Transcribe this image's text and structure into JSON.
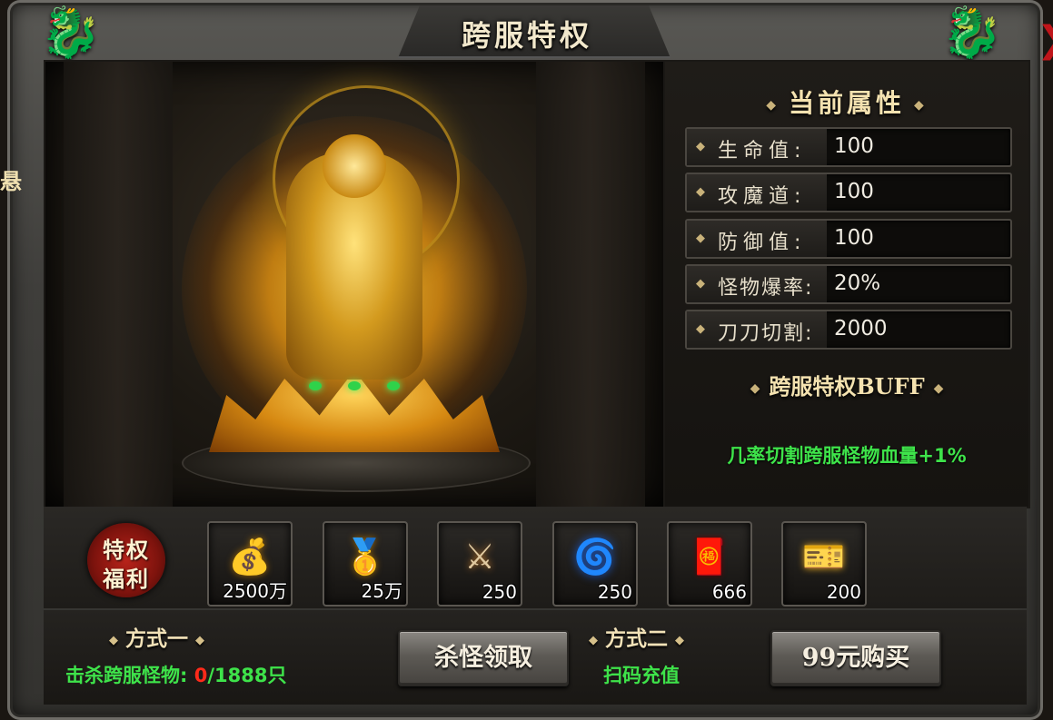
{
  "window": {
    "title": "跨服特权",
    "close_mark": "❯"
  },
  "left_edge_text": "悬",
  "current_attributes": {
    "heading": "当前属性",
    "rows": [
      {
        "label": "生命值:",
        "value": "100"
      },
      {
        "label": "攻魔道:",
        "value": "100"
      },
      {
        "label": "防御值:",
        "value": "100"
      },
      {
        "label": "怪物爆率:",
        "value": "20%"
      },
      {
        "label": "刀刀切割:",
        "value": "2000"
      }
    ]
  },
  "buff": {
    "heading": "跨服特权BUFF",
    "text": "几率切割跨服怪物血量+1%"
  },
  "benefits": {
    "badge_line1": "特权",
    "badge_line2": "福利",
    "items": [
      {
        "icon": "gold-pile-icon",
        "glyph": "💰",
        "qty": "2500万"
      },
      {
        "icon": "gold-ingot-icon",
        "glyph": "🥇",
        "qty": "25万"
      },
      {
        "icon": "sword-medallion-icon",
        "glyph": "⚔",
        "qty": "250"
      },
      {
        "icon": "blue-spirit-icon",
        "glyph": "🌀",
        "qty": "250"
      },
      {
        "icon": "red-envelope-icon",
        "glyph": "🧧",
        "qty": "666"
      },
      {
        "icon": "gold-card-icon",
        "glyph": "🎫",
        "qty": "200"
      }
    ]
  },
  "method1": {
    "heading": "方式一",
    "kill_label": "击杀跨服怪物:",
    "kill_current": "0",
    "kill_target": "/1888只",
    "button": "杀怪领取"
  },
  "method2": {
    "heading": "方式二",
    "text": "扫码充值",
    "button": "99元购买"
  },
  "ornament": "◆"
}
